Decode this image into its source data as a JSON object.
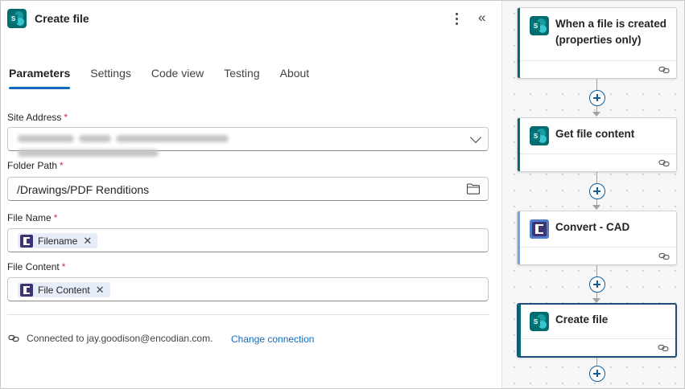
{
  "panel": {
    "title": "Create file",
    "icon": "sharepoint-icon",
    "tabs": [
      {
        "label": "Parameters",
        "active": true
      },
      {
        "label": "Settings",
        "active": false
      },
      {
        "label": "Code view",
        "active": false
      },
      {
        "label": "Testing",
        "active": false
      },
      {
        "label": "About",
        "active": false
      }
    ],
    "fields": {
      "site_address": {
        "label": "Site Address",
        "required": "*",
        "value": ""
      },
      "folder_path": {
        "label": "Folder Path",
        "required": "*",
        "value": "/Drawings/PDF Renditions"
      },
      "file_name": {
        "label": "File Name",
        "required": "*",
        "token": "Filename"
      },
      "file_content": {
        "label": "File Content",
        "required": "*",
        "token": "File Content"
      }
    },
    "token_remove_glyph": "✕",
    "connection": {
      "text": "Connected to jay.goodison@encodian.com.",
      "change_label": "Change connection"
    },
    "colors": {
      "accent": "#0f6cbd",
      "required": "#c4314b",
      "token_bg": "#e6edf8"
    }
  },
  "flow": {
    "steps": [
      {
        "title": "When a file is created (properties only)",
        "icon": "sharepoint-icon",
        "accent": "#036c70",
        "selected": false
      },
      {
        "title": "Get file content",
        "icon": "sharepoint-icon",
        "accent": "#036c70",
        "selected": false
      },
      {
        "title": "Convert - CAD",
        "icon": "encodian-icon",
        "accent": "#6ea6e8",
        "selected": false
      },
      {
        "title": "Create file",
        "icon": "sharepoint-icon",
        "accent": "#036c70",
        "selected": true
      }
    ]
  }
}
